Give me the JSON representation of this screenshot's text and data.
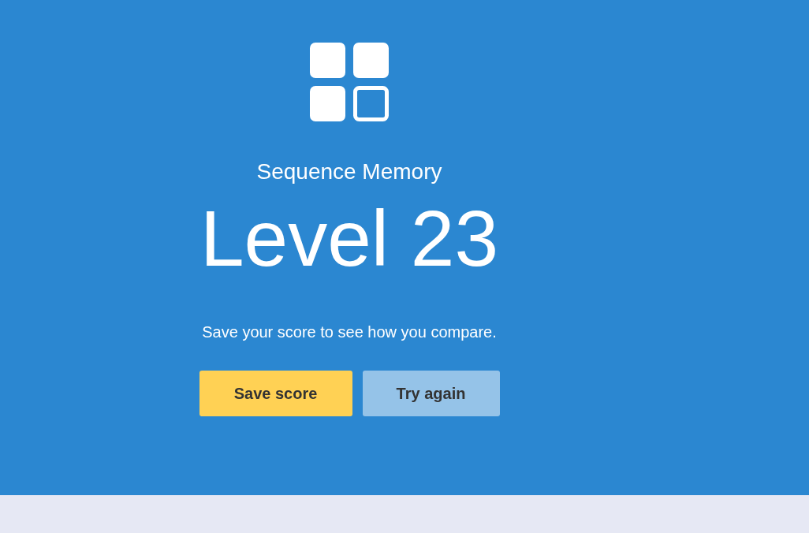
{
  "hero": {
    "title": "Sequence Memory",
    "result": "Level 23",
    "message": "Save your score to see how you compare.",
    "buttons": [
      {
        "label": "Save score",
        "kind": "primary"
      },
      {
        "label": "Try again",
        "kind": "secondary"
      }
    ]
  }
}
